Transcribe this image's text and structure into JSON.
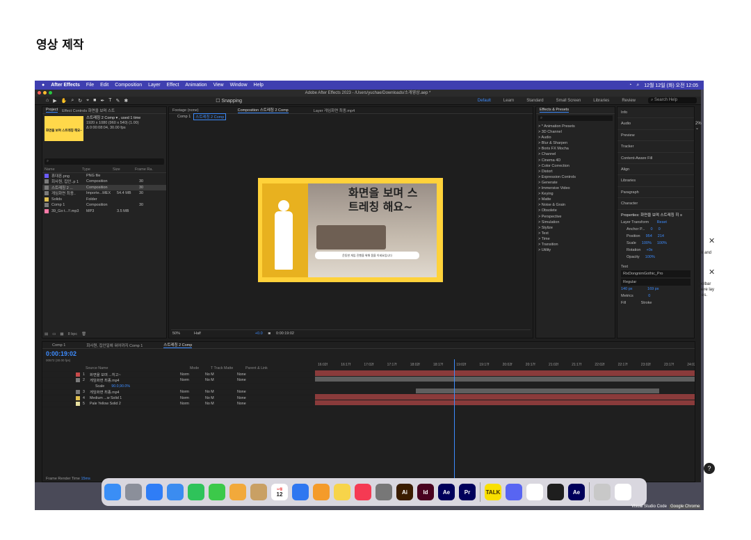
{
  "page_title": "영상 제작",
  "menubar": {
    "app": "After Effects",
    "items": [
      "File",
      "Edit",
      "Composition",
      "Layer",
      "Effect",
      "Animation",
      "View",
      "Window",
      "Help"
    ],
    "clock": "12월 12일 (화) 오전 12:05"
  },
  "window_title": "Adobe After Effects 2023 - /Users/yuchae/Downloads/소개영상.aep *",
  "toolbar": {
    "snapping": "Snapping",
    "workspaces": [
      "Default",
      "Learn",
      "Standard",
      "Small Screen",
      "Libraries",
      "Review"
    ],
    "search_placeholder": "Search Help"
  },
  "project": {
    "tab": "Project",
    "effect_controls_tab": "Effect Controls 화면을 보며 스트",
    "thumb_title": "화면을 보며 스트레칭 해요~",
    "info_name": "스트레칭 2 Comp ▾ , used 1 time",
    "info_size": "1920 x 1080 (960 x 540) (1.00)",
    "info_dur": "Δ 0:00:08:04, 30.00 fps",
    "headers": [
      "Name",
      "Type",
      "Size",
      "Frame Ra."
    ],
    "items": [
      {
        "name": "휴대폰.png",
        "type": "PNG file",
        "size": "",
        "fr": "",
        "color": "#6b5cff"
      },
      {
        "name": "회사원, 집안..p 1",
        "type": "Composition",
        "size": "",
        "fr": "30",
        "color": "#7a7a7a"
      },
      {
        "name": "스트레칭 2 ...",
        "type": "Composition",
        "size": "",
        "fr": "30",
        "color": "#7a7a7a"
      },
      {
        "name": "게임화면 최종..",
        "type": "Importe...MEX",
        "size": "54.4 MB",
        "fr": "30",
        "color": "#7a7a7a"
      },
      {
        "name": "Solids",
        "type": "Folder",
        "size": "",
        "fr": "",
        "color": "#e0c050"
      },
      {
        "name": "Comp 1",
        "type": "Composition",
        "size": "",
        "fr": "30",
        "color": "#7a7a7a"
      },
      {
        "name": "39_Go t...!!.mp3",
        "type": "MP3",
        "size": "3.5 MB",
        "fr": "",
        "color": "#ff7aa8"
      }
    ],
    "bpc": "8 bpc"
  },
  "viewer": {
    "tabs": [
      "Footage (none)",
      "Composition 스트레칭 2 Comp",
      "Layer 게임화면 최종.mp4"
    ],
    "breadcrumb": [
      "Comp 1",
      "스트레칭 2 Comp"
    ],
    "comp_title": "화면을 보며 스트레칭 해요~",
    "comp_caption": "운동한 게임 진행을 위해 몸을 이세요입니다",
    "zoom": "50%",
    "resolution": "Half",
    "exposure": "+0.0",
    "timecode": "0:00:19:02"
  },
  "effects": {
    "title": "Effects & Presets",
    "list": [
      "> * Animation Presets",
      "> 3D Channel",
      "> Audio",
      "> Blur & Sharpen",
      "> Boris FX Mocha",
      "> Channel",
      "> Cinema 4D",
      "> Color Correction",
      "> Distort",
      "> Expression Controls",
      "> Generate",
      "> Immersive Video",
      "> Keying",
      "> Matte",
      "> Noise & Grain",
      "> Obsolete",
      "> Perspective",
      "> Simulation",
      "> Stylize",
      "> Text",
      "> Time",
      "> Transition",
      "> Utility"
    ]
  },
  "right_panels": [
    "Info",
    "Audio",
    "Preview",
    "Tracker",
    "Content-Aware Fill",
    "Align",
    "Libraries",
    "Paragraph",
    "Character"
  ],
  "properties": {
    "title": "Properties: 화면을 보며 스트레칭 히 ≡",
    "transform": "Layer Transform",
    "reset": "Reset",
    "rows": [
      {
        "label": "Anchor P...",
        "v1": "0",
        "v2": "0"
      },
      {
        "label": "Position",
        "v1": "954",
        "v2": "214"
      },
      {
        "label": "Scale",
        "v1": "100%",
        "v2": "100%"
      },
      {
        "label": "Rotation",
        "v1": "+0x",
        "v2": ""
      },
      {
        "label": "Opacity",
        "v1": "100%",
        "v2": ""
      }
    ],
    "text_label": "Text",
    "font": "RixDongnimGothic_Pro",
    "style": "Regular",
    "size": "140 px",
    "leading": "169 px",
    "metrics": "Metrics",
    "tracking": "0",
    "fill": "Fill",
    "stroke": "Stroke"
  },
  "zoom_right": "2% ⌄",
  "timeline": {
    "tabs": [
      "Comp 1",
      "회사원, 집안일에 워어까지 Comp 1",
      "스트레칭 2 Comp"
    ],
    "timecode": "0:00:19:02",
    "frames": "00572 (30.00 fps)",
    "headers": [
      "Source Name",
      "Mode",
      "T  Track Matte",
      "Parent & Link"
    ],
    "layers": [
      {
        "num": "1",
        "name": "화면을 보며 ...히고~",
        "color": "#c84a4a",
        "mode": "Norm",
        "matte": "No M",
        "parent": "None",
        "bar": "#8a3b3b"
      },
      {
        "num": "2",
        "name": "게임화면 최종.mp4",
        "color": "#7a7a7a",
        "mode": "Norm",
        "matte": "No M",
        "parent": "None",
        "bar": "#5f5f5f"
      },
      {
        "num": "3",
        "name": "게임화면 최종.mp4",
        "color": "#7a7a7a",
        "mode": "Norm",
        "matte": "No M",
        "parent": "None",
        "bar": "#5f5f5f"
      },
      {
        "num": "4",
        "name": "Medium ...w Solid 1",
        "color": "#e0c050",
        "mode": "Norm",
        "matte": "No M",
        "parent": "None",
        "bar": "#8a3b3b"
      },
      {
        "num": "5",
        "name": "Pale Yellow Solid 2",
        "color": "#e8e0a0",
        "mode": "Norm",
        "matte": "No M",
        "parent": "None",
        "bar": "#8a3b3b"
      }
    ],
    "scale_label": "Scale",
    "scale_value": "90.0,90.0%",
    "ruler": [
      "16:02f",
      "16:17f",
      "17:02f",
      "17:17f",
      "18:02f",
      "18:17f",
      "19:02f",
      "19:17f",
      "20:02f",
      "20:17f",
      "21:02f",
      "21:17f",
      "22:02f",
      "22:17f",
      "23:02f",
      "23:17f",
      "24:02f"
    ],
    "render_time_label": "Frame Render Time",
    "render_time": "15ms"
  },
  "dock": [
    "finder",
    "launchpad",
    "safari",
    "mail",
    "facetime",
    "messages",
    "photos",
    "notes-app",
    "calendar",
    "freeform",
    "pages",
    "notes",
    "music",
    "settings",
    "ai",
    "id",
    "ae",
    "pr",
    "kakao",
    "discord",
    "chrome",
    "figma",
    "ae2",
    "trash",
    "chrome2"
  ],
  "dock_calendar": {
    "month": "12월",
    "day": "12"
  },
  "dock_labels": {
    "ai": "Ai",
    "id": "Id",
    "ae": "Ae",
    "pr": "Pr",
    "kakao": "TALK",
    "ae2": "Ae"
  },
  "hover_labels": [
    "Visual Studio Code",
    "Google Chrome"
  ],
  "side_panel": {
    "text1": "ick and",
    "text2": "toolbar there lay a es.",
    "help": "?"
  }
}
